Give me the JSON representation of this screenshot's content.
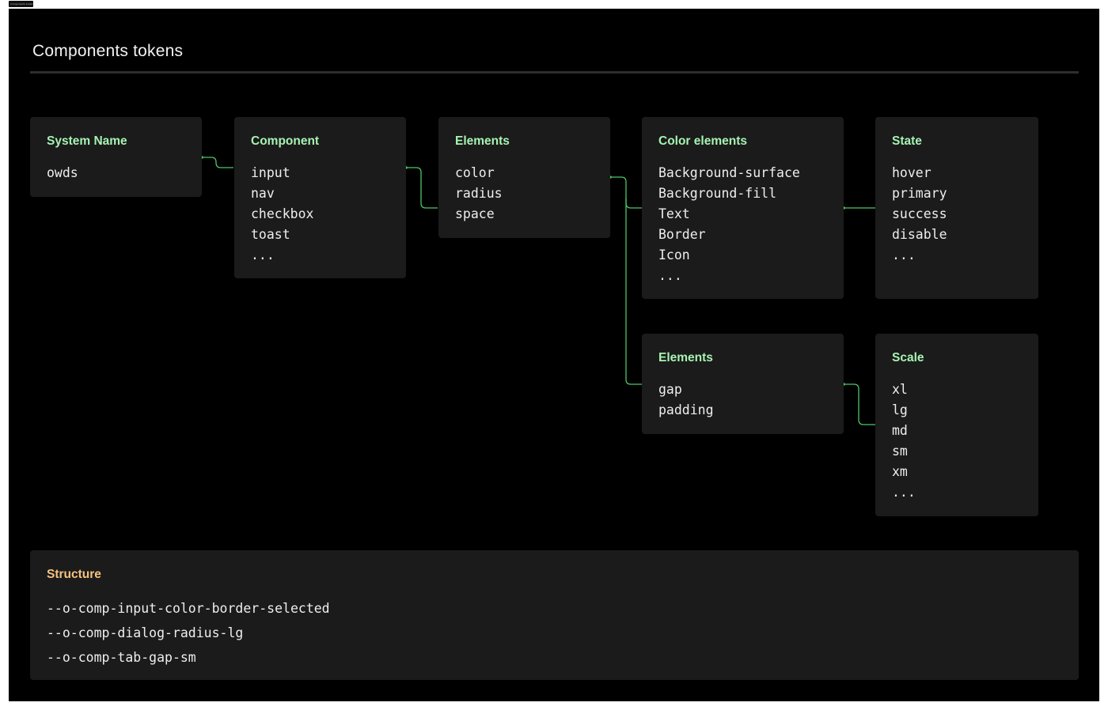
{
  "frame_label": "Components tokens",
  "page": {
    "title": "Components tokens"
  },
  "colors": {
    "background": "#000000",
    "card": "#1b1b1b",
    "accent_green": "#a7f3b3",
    "accent_orange": "#f7c27e",
    "connector": "#4cc56a"
  },
  "cards": {
    "system_name": {
      "title": "System Name",
      "items": [
        "owds"
      ]
    },
    "component": {
      "title": "Component",
      "items": [
        "input",
        "nav",
        "checkbox",
        "toast",
        "..."
      ]
    },
    "elements_main": {
      "title": "Elements",
      "items": [
        "color",
        "radius",
        "space"
      ]
    },
    "color_elements": {
      "title": "Color elements",
      "items": [
        "Background-surface",
        "Background-fill",
        "Text",
        "Border",
        "Icon",
        "..."
      ]
    },
    "state": {
      "title": "State",
      "items": [
        "hover",
        "primary",
        "success",
        "disable",
        "..."
      ]
    },
    "elements_space": {
      "title": "Elements",
      "items": [
        "gap",
        "padding"
      ]
    },
    "scale": {
      "title": "Scale",
      "items": [
        "xl",
        "lg",
        "md",
        "sm",
        "xm",
        "..."
      ]
    },
    "structure": {
      "title": "Structure",
      "items": [
        "--o-comp-input-color-border-selected",
        "--o-comp-dialog-radius-lg",
        "--o-comp-tab-gap-sm"
      ]
    }
  }
}
